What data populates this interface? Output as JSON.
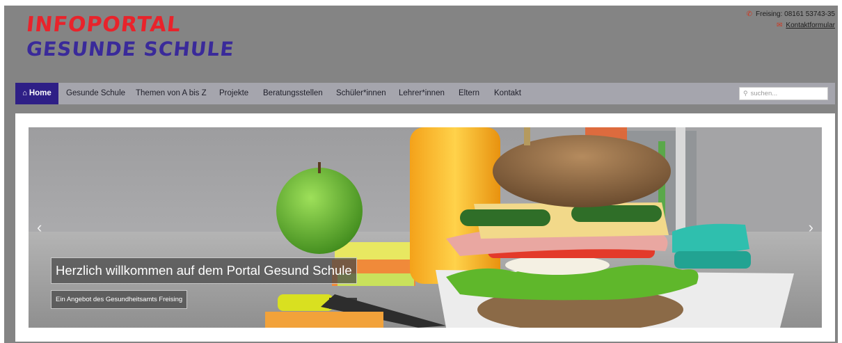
{
  "header": {
    "logo": {
      "line1": "INFOPORTAL",
      "line2": "GESUNDE SCHULE"
    },
    "contact": {
      "phone": "Freising: 08161 53743-35",
      "phone_icon": "phone-icon",
      "form_link": "Kontaktformular",
      "form_icon": "envelope-icon"
    }
  },
  "nav": {
    "home": {
      "label": "Home",
      "icon": "home-icon"
    },
    "items": [
      {
        "label": "Gesunde Schule"
      },
      {
        "label": "Themen von A bis Z"
      },
      {
        "label": "Projekte"
      },
      {
        "label": "Beratungsstellen"
      },
      {
        "label": "Schüler*innen"
      },
      {
        "label": "Lehrer*innen"
      },
      {
        "label": "Eltern"
      },
      {
        "label": "Kontakt"
      }
    ],
    "search": {
      "placeholder": "suchen...",
      "icon": "search-icon"
    }
  },
  "slider": {
    "caption_title": "Herzlich willkommen auf dem Portal Gesund Schule",
    "caption_subtitle": "Ein Angebot des Gesundheitsamts Freising",
    "prev_icon": "chevron-left-icon",
    "next_icon": "chevron-right-icon"
  },
  "colors": {
    "header_bg": "#848484",
    "nav_bg": "#a5a5ad",
    "nav_active": "#2e1f86",
    "logo_red": "#e8232b",
    "logo_blue": "#3a2a9a"
  }
}
